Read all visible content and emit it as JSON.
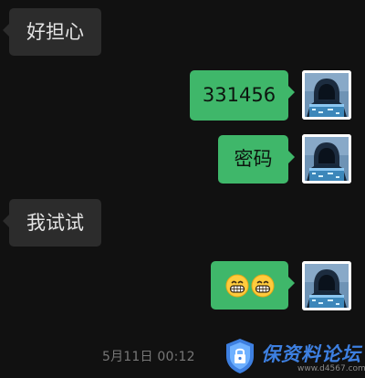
{
  "messages": [
    {
      "direction": "incoming",
      "text": "好担心"
    },
    {
      "direction": "outgoing",
      "text": "331456"
    },
    {
      "direction": "outgoing",
      "text": "密码"
    },
    {
      "direction": "incoming",
      "text": "我试试"
    },
    {
      "direction": "outgoing",
      "emoji": [
        "grinning-face-emoji",
        "grinning-face-emoji"
      ]
    }
  ],
  "timestamp": "5月11日 00:12",
  "watermark": {
    "title": "保资料论坛",
    "url": "www.d4567.com"
  },
  "colors": {
    "background": "#111111",
    "incoming_bubble": "#2c2c2c",
    "outgoing_bubble": "#3fb76a",
    "watermark_blue": "#3d7fe0"
  }
}
